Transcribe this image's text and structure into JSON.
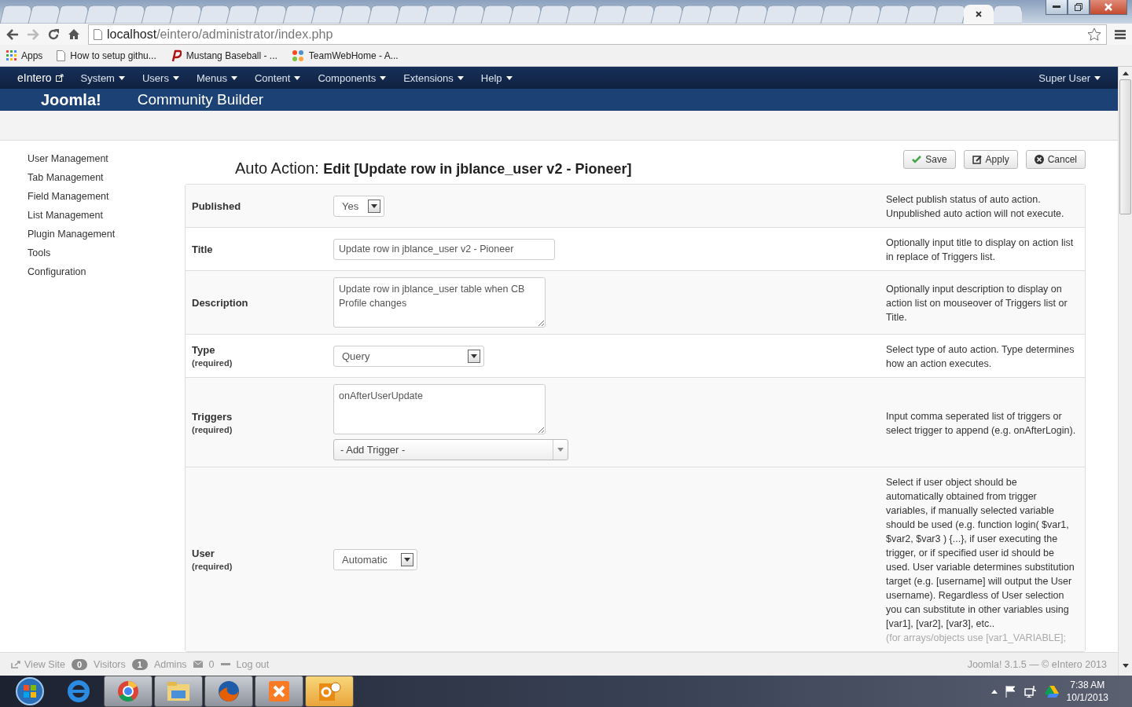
{
  "browser": {
    "url_host": "localhost",
    "url_path": "/eintero/administrator/index.php",
    "bookmarks": [
      {
        "label": "Apps",
        "kind": "apps"
      },
      {
        "label": "How to setup githu...",
        "kind": "page"
      },
      {
        "label": "Mustang Baseball - ...",
        "kind": "p"
      },
      {
        "label": "TeamWebHome - A...",
        "kind": "joomla"
      }
    ]
  },
  "nav": {
    "brand": "eIntero",
    "menus": [
      "System",
      "Users",
      "Menus",
      "Content",
      "Components",
      "Extensions",
      "Help"
    ],
    "user": "Super User"
  },
  "banner": {
    "logo": "Joomla!",
    "title": "Community Builder"
  },
  "sidebar": {
    "items": [
      "User Management",
      "Tab Management",
      "Field Management",
      "List Management",
      "Plugin Management",
      "Tools",
      "Configuration"
    ]
  },
  "page": {
    "title_prefix": "Auto Action:",
    "title": "Edit [Update row in jblance_user v2 - Pioneer]",
    "buttons": [
      {
        "label": "Save",
        "kind": "save"
      },
      {
        "label": "Apply",
        "kind": "apply"
      },
      {
        "label": "Cancel",
        "kind": "cancel"
      }
    ]
  },
  "form": [
    {
      "label": "Published",
      "kind": "select",
      "value": "Yes",
      "help": "Select publish status of auto action. Unpublished auto action will not execute."
    },
    {
      "label": "Title",
      "kind": "input",
      "value": "Update row in jblance_user v2 - Pioneer",
      "help": "Optionally input title to display on action list in replace of Triggers list."
    },
    {
      "label": "Description",
      "kind": "textarea",
      "value": "Update row in jblance_user table when CB Profile changes",
      "help": "Optionally input description to display on action list on mouseover of Triggers list or Title."
    },
    {
      "label": "Type",
      "required": "(required)",
      "kind": "wide_select",
      "value": "Query",
      "help": "Select type of auto action. Type determines how an action executes."
    },
    {
      "label": "Triggers",
      "required": "(required)",
      "kind": "textarea_picker",
      "value": "onAfterUserUpdate",
      "picker": "- Add Trigger -",
      "help": "Input comma seperated list of triggers or select trigger to append (e.g. onAfterLogin)."
    },
    {
      "label": "User",
      "required": "(required)",
      "kind": "select",
      "value": "Automatic",
      "help": "Select if user object should be automatically obtained from trigger variables, if manually selected variable should be used (e.g. function login( $var1, $var2, $var3 ) {...}, if user executing the trigger, or if specified user id should be used. User variable determines substitution target (e.g. [username] will output the User username). Regardless of User selection you can substitute in other variables using [var1], [var2], [var3], etc..",
      "help_faded": "(for arrays/objects use [var1_VARIABLE];"
    }
  ],
  "footer": {
    "view_site": "View Site",
    "visitors_count": "0",
    "visitors": "Visitors",
    "admins_count": "1",
    "admins": "Admins",
    "messages_count": "0",
    "logout": "Log out",
    "version": "Joomla! 3.1.5 — © eIntero 2013"
  },
  "taskbar": {
    "time": "7:38 AM",
    "date": "10/1/2013"
  }
}
